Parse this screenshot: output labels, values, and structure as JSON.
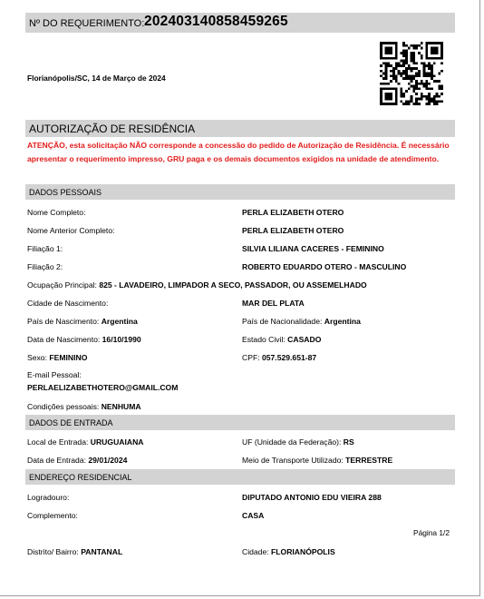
{
  "header": {
    "req_label": "Nº DO REQUERIMENTO:",
    "req_number": "202403140858459265"
  },
  "date_line": "Florianópolis/SC, 14 de Março de 2024",
  "qr_icon": "qr-code",
  "auth": {
    "title": "AUTORIZAÇÃO DE RESIDÊNCIA",
    "warning": "ATENÇÃO, esta solicitação NÃO corresponde a concessão do pedido de Autorização de Residência. É necessário apresentar o requerimento impresso, GRU paga e os demais documentos exigidos na unidade de atendimento."
  },
  "personal": {
    "title": "DADOS PESSOAIS",
    "nome_label": "Nome Completo:",
    "nome": "PERLA ELIZABETH OTERO",
    "nome_ant_label": "Nome Anterior Completo:",
    "nome_ant": "PERLA ELIZABETH OTERO",
    "fil1_label": "Filiação 1:",
    "fil1": "SILVIA LILIANA CACERES - FEMININO",
    "fil2_label": "Filiação 2:",
    "fil2": "ROBERTO EDUARDO OTERO - MASCULINO",
    "ocup_label": "Ocupação Principal:",
    "ocup": "825 - LAVADEIRO, LIMPADOR A SECO, PASSADOR, OU ASSEMELHADO",
    "cidade_label": "Cidade de Nascimento:",
    "cidade": "MAR DEL PLATA",
    "pais_nasc_label": "País de Nascimento:",
    "pais_nasc": "Argentina",
    "pais_nac_label": "País de Nacionalidade:",
    "pais_nac": "Argentina",
    "data_nasc_label": "Data de Nascimento:",
    "data_nasc": "16/10/1990",
    "civil_label": "Estado Civil:",
    "civil": "CASADO",
    "sexo_label": "Sexo:",
    "sexo": "FEMININO",
    "cpf_label": "CPF:",
    "cpf": "057.529.651-87",
    "email_label": "E-mail Pessoal:",
    "email": "PERLAELIZABETHOTERO@GMAIL.COM",
    "cond_label": "Condições pessoais:",
    "cond": "NENHUMA"
  },
  "entry": {
    "title": "DADOS DE ENTRADA",
    "local_label": "Local de Entrada:",
    "local": "URUGUAIANA",
    "uf_label": "UF (Unidade da Federação):",
    "uf": "RS",
    "data_label": "Data de Entrada:",
    "data": "29/01/2024",
    "meio_label": "Meio de Transporte Utilizado:",
    "meio": "TERRESTRE"
  },
  "address": {
    "title": "ENDEREÇO RESIDENCIAL",
    "log_label": "Logradouro:",
    "log": "DIPUTADO ANTONIO EDU VIEIRA 288",
    "comp_label": "Complemento:",
    "comp": "CASA",
    "bairro_label": "Distrito/ Bairro:",
    "bairro": "PANTANAL",
    "cidade_label": "Cidade:",
    "cidade": "FLORIANÓPOLIS"
  },
  "page_label": "Página 1/2"
}
